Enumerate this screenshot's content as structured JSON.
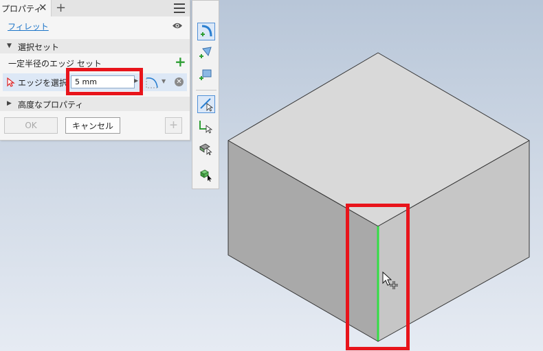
{
  "panel": {
    "tab_label": "プロパティ",
    "tab_close": "✕",
    "tab_add": "+",
    "command_name": "フィレット",
    "section_select_set": "選択セット",
    "constant_radius_set": "一定半径のエッジ セット",
    "add_set_symbol": "+",
    "edge_select_label": "エッジを選択",
    "radius_value": "5 mm",
    "section_advanced": "高度なプロパティ",
    "ok_label": "OK",
    "cancel_label": "キャンセル",
    "apply_symbol": "+"
  },
  "icons": {
    "tab": "close-icon",
    "menu": "hamburger-menu-icon",
    "visibility": "eye-icon",
    "edge_select": "select-cursor-icon",
    "profile": "fillet-profile-icon",
    "clear": "clear-icon"
  },
  "toolbar_icons": [
    "fillet-edge-icon",
    "fillet-face-icon",
    "fillet-full-round-icon",
    "select-edge-icon",
    "select-loop-icon",
    "select-feature-icon",
    "select-body-icon"
  ],
  "colors": {
    "accent": "#1a73c8",
    "add_green": "#2e9e34",
    "highlight_red": "#e8141b",
    "selected_edge": "#33dd44",
    "box_top": "#d9d9d9",
    "box_left": "#a9a9a9",
    "box_right": "#c6c6c6"
  }
}
